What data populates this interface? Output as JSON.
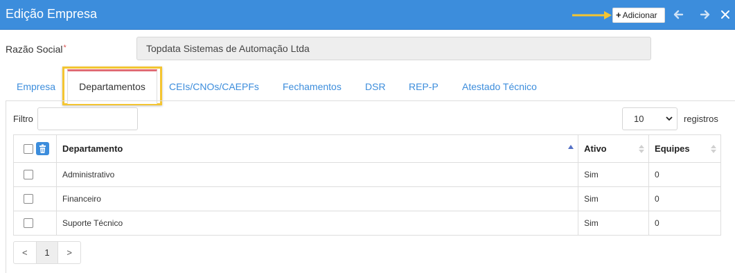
{
  "window": {
    "title": "Edição Empresa",
    "add_label": "Adicionar",
    "icons": [
      "arrow-left-icon",
      "arrow-right-icon",
      "close-icon"
    ],
    "accent": "#3c8ddc",
    "highlight": "#f4c531"
  },
  "form": {
    "razao_label": "Razão Social",
    "required_mark": "*",
    "razao_value": "Topdata Sistemas de Automação Ltda"
  },
  "tabs": [
    {
      "label": "Empresa",
      "active": false
    },
    {
      "label": "Departamentos",
      "active": true
    },
    {
      "label": "CEIs/CNOs/CAEPFs",
      "active": false
    },
    {
      "label": "Fechamentos",
      "active": false
    },
    {
      "label": "DSR",
      "active": false
    },
    {
      "label": "REP-P",
      "active": false
    },
    {
      "label": "Atestado Técnico",
      "active": false
    }
  ],
  "list": {
    "filter_label": "Filtro",
    "filter_value": "",
    "page_size": "10",
    "page_size_suffix": "registros",
    "columns": [
      "Departamento",
      "Ativo",
      "Equipes"
    ],
    "rows": [
      {
        "departamento": "Administrativo",
        "ativo": "Sim",
        "equipes": "0"
      },
      {
        "departamento": "Financeiro",
        "ativo": "Sim",
        "equipes": "0"
      },
      {
        "departamento": "Suporte Técnico",
        "ativo": "Sim",
        "equipes": "0"
      }
    ],
    "pagination": {
      "prev": "<",
      "current": "1",
      "next": ">"
    }
  }
}
